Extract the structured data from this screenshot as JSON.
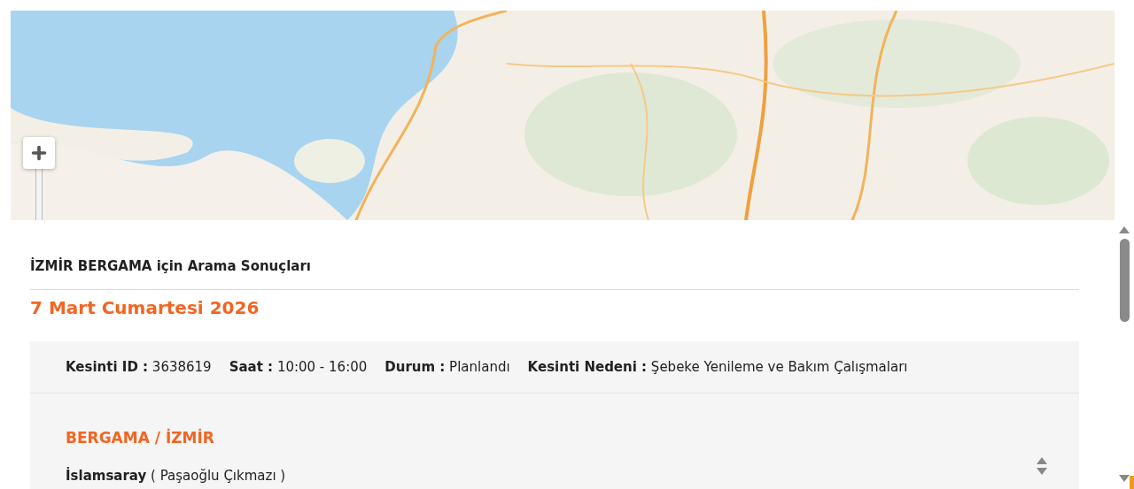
{
  "results_title": "İZMİR BERGAMA için Arama Sonuçları",
  "date": "7 Mart Cumartesi 2026",
  "outage": {
    "fields": [
      {
        "text": "**Kesinti ID :** 3638619"
      },
      {
        "text": "**Saat :** 10:00 - 16:00"
      },
      {
        "text": "**Durum :** Planlandı"
      },
      {
        "text": "**Kesinti Nedeni :** Şebeke Yenileme ve Bakım Çalışmaları"
      }
    ],
    "location": "BERGAMA / İZMİR",
    "addresses": [
      "**İslamsaray** ( Paşaoğlu Çıkmazı )"
    ]
  }
}
